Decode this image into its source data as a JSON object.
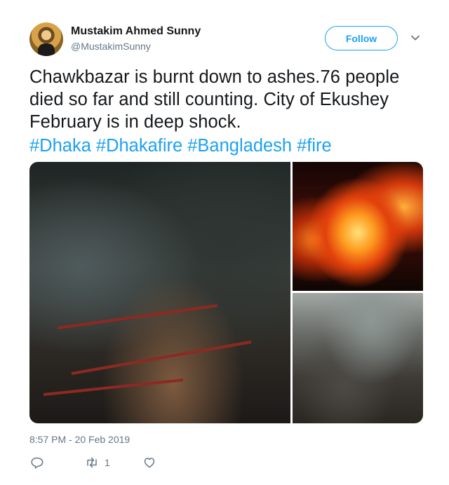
{
  "tweet": {
    "author_name": "Mustakim Ahmed Sunny",
    "author_handle": "@MustakimSunny",
    "follow_label": "Follow",
    "text": "Chawkbazar is burnt down to ashes.76 people died so far and still counting. City of Ekushey February is in deep shock.",
    "hashtags": [
      "#Dhaka",
      "#Dhakafire",
      "#Bangladesh",
      "#fire"
    ],
    "timestamp": "8:57 PM - 20 Feb 2019",
    "media": [
      {
        "icon": "photo-firefighters-in-ruins"
      },
      {
        "icon": "photo-building-on-fire"
      },
      {
        "icon": "photo-burnt-street"
      }
    ],
    "actions": {
      "reply": {
        "icon": "reply-icon",
        "count": ""
      },
      "retweet": {
        "icon": "retweet-icon",
        "count": "1"
      },
      "like": {
        "icon": "heart-icon",
        "count": ""
      }
    }
  },
  "colors": {
    "accent": "#1da1f2",
    "text": "#14171a",
    "secondary": "#657786"
  }
}
